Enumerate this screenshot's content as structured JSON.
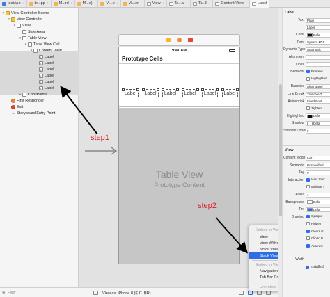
{
  "tabs": [
    {
      "label": "testApp",
      "active": false
    },
    {
      "label": "te...pp",
      "active": false
    },
    {
      "label": "M...rd",
      "active": false
    },
    {
      "label": "M...e)",
      "active": false
    },
    {
      "label": "Vi...e",
      "active": false
    },
    {
      "label": "Vi...er",
      "active": false
    },
    {
      "label": "View",
      "active": false
    },
    {
      "label": "Ta...w",
      "active": false
    },
    {
      "label": "Ta...ll",
      "active": false
    },
    {
      "label": "Content View",
      "active": false
    },
    {
      "label": "Label",
      "active": true
    }
  ],
  "navigator": {
    "rows": [
      {
        "label": "View Controller Scene",
        "icon": "scene-icon"
      },
      {
        "label": "View Controller",
        "icon": "view-controller-icon"
      },
      {
        "label": "View",
        "icon": "view-icon"
      },
      {
        "label": "Safe Area",
        "icon": "safe-area-icon"
      },
      {
        "label": "Table View",
        "icon": "table-view-icon"
      },
      {
        "label": "Table View Cell",
        "icon": "table-cell-icon"
      },
      {
        "label": "Content View",
        "icon": "content-view-icon"
      },
      {
        "label": "Label",
        "icon": "label-icon"
      },
      {
        "label": "Label",
        "icon": "label-icon"
      },
      {
        "label": "Label",
        "icon": "label-icon"
      },
      {
        "label": "Label",
        "icon": "label-icon"
      },
      {
        "label": "Label",
        "icon": "label-icon"
      },
      {
        "label": "Label",
        "icon": "label-icon"
      },
      {
        "label": "Constraints",
        "icon": "constraints-icon"
      },
      {
        "label": "First Responder",
        "icon": "first-responder-icon"
      },
      {
        "label": "Exit",
        "icon": "exit-icon"
      },
      {
        "label": "Storyboard Entry Point",
        "icon": "entry-point-icon"
      }
    ],
    "filter_placeholder": "Filter"
  },
  "canvas": {
    "time": "9:41 AM",
    "prototype_cells": "Prototype Cells",
    "cell_labels": [
      "Label",
      "Label",
      "Label",
      "Label",
      "Label",
      "Label"
    ],
    "table_view_title": "Table View",
    "table_view_subtitle": "Prototype Content",
    "view_as": "View as: iPhone 8 (ⒸC ⓇR)"
  },
  "embed_menu": {
    "header_view": "Embed in View",
    "items_view": [
      "View",
      "View Without Inset",
      "Scroll View",
      "Stack View"
    ],
    "selected": "Stack View",
    "header_controller": "Embed in View Controller",
    "items_controller": [
      "Navigation Controller",
      "Tab Bar Controller"
    ],
    "footer": "Unembed"
  },
  "inspector": {
    "section_label": "Label",
    "rows_label": [
      {
        "key": "Text",
        "value": "Plain"
      },
      {
        "key": "",
        "value": "Label"
      },
      {
        "key": "Color",
        "value": "Defa"
      },
      {
        "key": "Font",
        "value": "System 17.0"
      },
      {
        "key": "Dynamic Type",
        "value": "Automatic"
      },
      {
        "key": "Alignment",
        "value": ""
      },
      {
        "key": "Lines",
        "value": "1"
      },
      {
        "key": "Behavior",
        "value": "Enabled"
      },
      {
        "key": "",
        "value": "Highlighted"
      },
      {
        "key": "Baseline",
        "value": "Align Basel"
      },
      {
        "key": "Line Break",
        "value": "Truncate T"
      },
      {
        "key": "Autoshrink",
        "value": "Fixed Font"
      },
      {
        "key": "",
        "value": "Tighten"
      },
      {
        "key": "Highlighted",
        "value": "Defa"
      },
      {
        "key": "Shadow",
        "value": "Defa"
      },
      {
        "key": "Shadow Offset",
        "value": "0"
      }
    ],
    "section_view": "View",
    "rows_view": [
      {
        "key": "Content Mode",
        "value": "Left"
      },
      {
        "key": "Semantic",
        "value": "Unspecified"
      },
      {
        "key": "Tag",
        "value": "0"
      },
      {
        "key": "Interaction",
        "value": "User Inter"
      },
      {
        "key": "",
        "value": "Multiple T"
      },
      {
        "key": "Alpha",
        "value": "1"
      },
      {
        "key": "Background",
        "value": "Defa"
      },
      {
        "key": "Tint",
        "value": "Defa"
      },
      {
        "key": "Drawing",
        "value": "Opaque"
      },
      {
        "key": "",
        "value": "Hidden"
      },
      {
        "key": "",
        "value": "Clears G"
      },
      {
        "key": "",
        "value": "Clip to B"
      },
      {
        "key": "",
        "value": "Autoresi"
      }
    ],
    "width_label": "Width",
    "installed": "Installed"
  },
  "annotations": {
    "step1": "step1",
    "step2": "step2"
  },
  "colors": {
    "annotation": "#d8232a",
    "selection": "#2d6ee6"
  }
}
